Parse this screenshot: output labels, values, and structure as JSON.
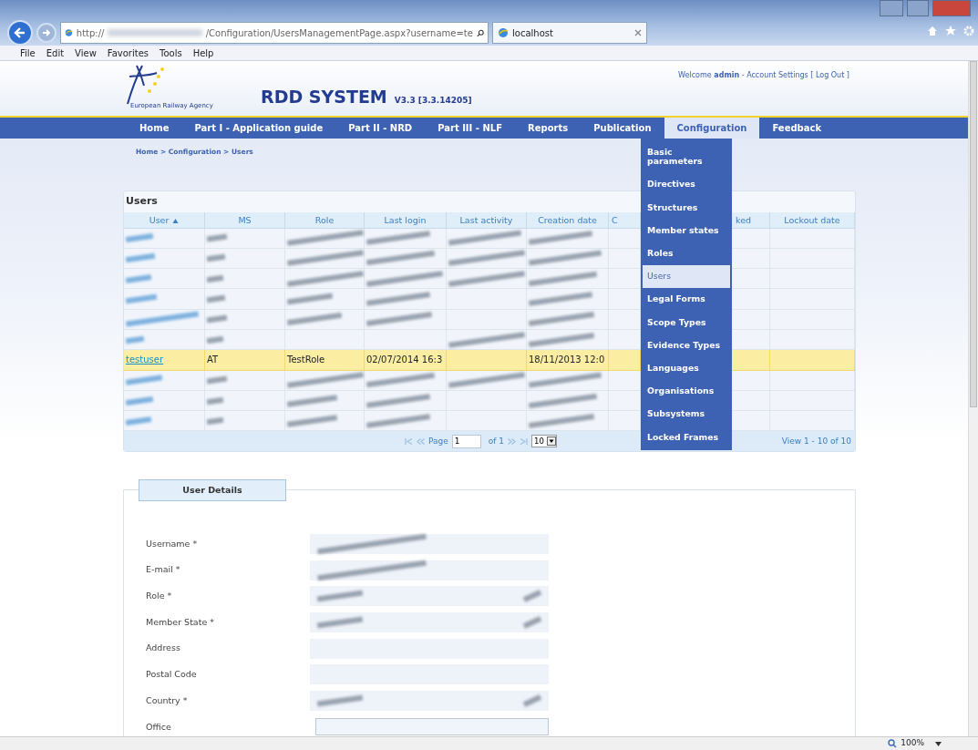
{
  "browser": {
    "address_start": "http://",
    "address_end": "/Configuration/UsersManagementPage.aspx?username=te",
    "tab": "localhost",
    "menu": [
      "File",
      "Edit",
      "View",
      "Favorites",
      "Tools",
      "Help"
    ],
    "zoom": "100%"
  },
  "header": {
    "agency": "European Railway Agency",
    "title": "RDD SYSTEM",
    "version": "V3.3 [3.3.14205]",
    "welcome": "Welcome **admin** - Account Settings [ Log Out ]"
  },
  "nav": [
    {
      "label": "Home",
      "selected": false
    },
    {
      "label": "Part I - Application guide",
      "selected": false
    },
    {
      "label": "Part II - NRD",
      "selected": false
    },
    {
      "label": "Part III - NLF",
      "selected": false
    },
    {
      "label": "Reports",
      "selected": false
    },
    {
      "label": "Publication",
      "selected": false
    },
    {
      "label": "Configuration",
      "selected": true
    },
    {
      "label": "Feedback",
      "selected": false
    }
  ],
  "dropdown": [
    {
      "label": "Basic parameters",
      "selected": false
    },
    {
      "label": "Directives",
      "selected": false
    },
    {
      "label": "Structures",
      "selected": false
    },
    {
      "label": "Member states",
      "selected": false
    },
    {
      "label": "Roles",
      "selected": false
    },
    {
      "label": "Users",
      "selected": true
    },
    {
      "label": "Legal Forms",
      "selected": false
    },
    {
      "label": "Scope Types",
      "selected": false
    },
    {
      "label": "Evidence Types",
      "selected": false
    },
    {
      "label": "Languages",
      "selected": false
    },
    {
      "label": "Organisations",
      "selected": false
    },
    {
      "label": "Subsystems",
      "selected": false
    },
    {
      "label": "Locked Frames",
      "selected": false
    }
  ],
  "breadcrumb": "Home > Configuration > Users",
  "users_table": {
    "title": "Users",
    "columns": [
      {
        "label": "User",
        "sorted": true
      },
      {
        "label": "MS",
        "sorted": false
      },
      {
        "label": "Role",
        "sorted": false
      },
      {
        "label": "Last login",
        "sorted": false
      },
      {
        "label": "Last activity",
        "sorted": false
      },
      {
        "label": "Creation date",
        "sorted": false
      },
      {
        "label": "C",
        "sorted": false
      },
      {
        "label": "ked",
        "sorted": false
      },
      {
        "label": "Lockout date",
        "sorted": false
      }
    ],
    "rows": [
      {
        "kind": "redacted",
        "selected": false
      },
      {
        "kind": "redacted",
        "selected": false
      },
      {
        "kind": "redacted",
        "selected": false
      },
      {
        "kind": "redacted",
        "selected": false
      },
      {
        "kind": "redacted",
        "selected": false
      },
      {
        "kind": "redacted",
        "selected": false
      },
      {
        "kind": "data",
        "selected": true,
        "user": "testuser",
        "ms": "AT",
        "role": "TestRole",
        "last_login": "02/07/2014 16:3",
        "creation_date": "18/11/2013 12:0"
      },
      {
        "kind": "redacted",
        "selected": false
      },
      {
        "kind": "redacted",
        "selected": false
      },
      {
        "kind": "redacted",
        "selected": false
      }
    ],
    "pager": {
      "page_label": "Page",
      "page": "1",
      "of": "of 1",
      "page_size": "10",
      "summary": "View 1 - 10 of 10"
    }
  },
  "details": {
    "title": "User Details",
    "fields": [
      {
        "label": "Username *",
        "kind": "text",
        "redacted": true,
        "filled": true
      },
      {
        "label": "E-mail *",
        "kind": "text",
        "redacted": true,
        "filled": true
      },
      {
        "label": "Role *",
        "kind": "select",
        "redacted": true,
        "filled": true
      },
      {
        "label": "Member State *",
        "kind": "select",
        "redacted": true,
        "filled": true
      },
      {
        "label": "Address",
        "kind": "text",
        "redacted": true,
        "filled": false
      },
      {
        "label": "Postal Code",
        "kind": "text",
        "redacted": true,
        "filled": false
      },
      {
        "label": "Country *",
        "kind": "select",
        "redacted": true,
        "filled": true
      },
      {
        "label": "Office",
        "kind": "text",
        "redacted": false,
        "filled": false
      }
    ]
  }
}
